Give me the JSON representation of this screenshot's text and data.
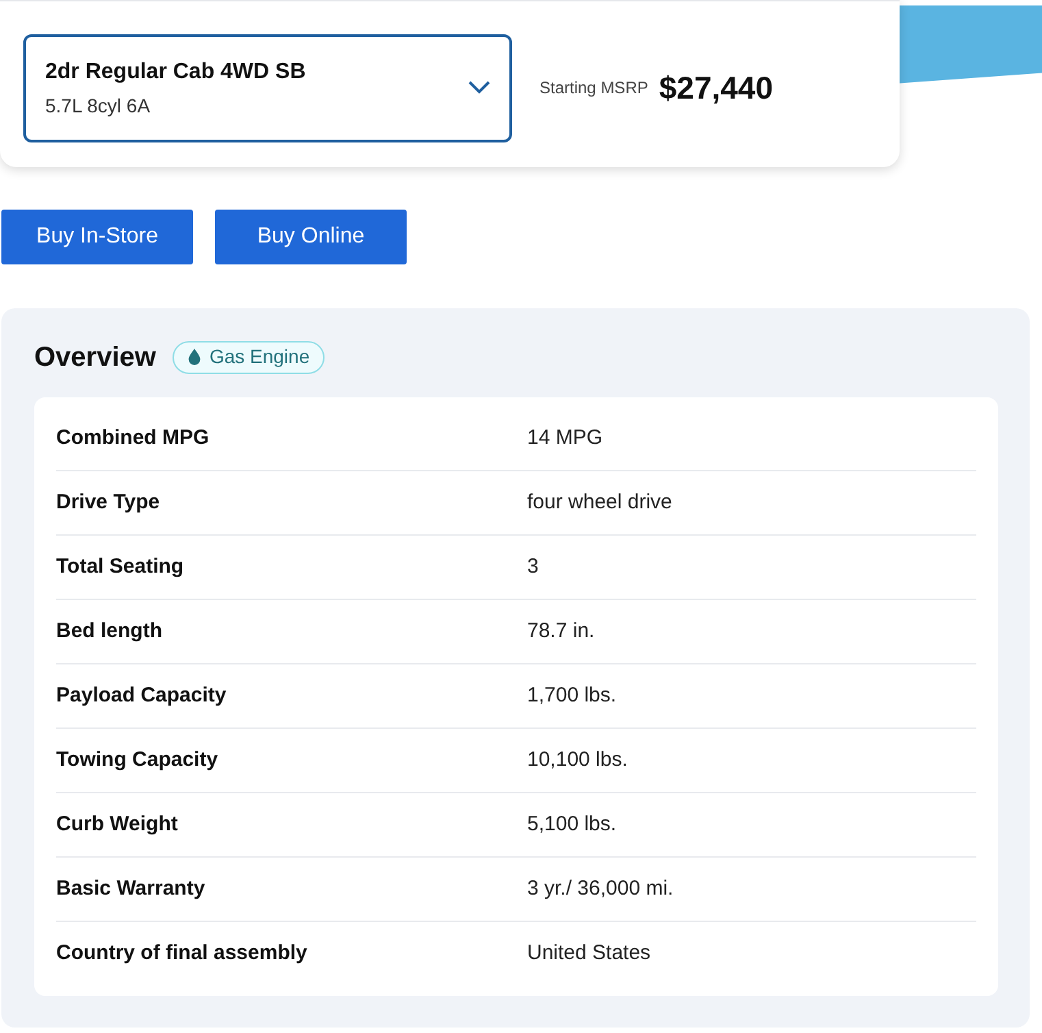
{
  "trim": {
    "name": "2dr Regular Cab 4WD SB",
    "engine": "5.7L 8cyl 6A"
  },
  "price": {
    "label": "Starting MSRP",
    "value": "$27,440"
  },
  "buttons": [
    "Buy In-Store",
    "Buy Online"
  ],
  "overview": {
    "title": "Overview",
    "badge": "Gas Engine",
    "rows": [
      {
        "label": "Combined MPG",
        "value": "14 MPG"
      },
      {
        "label": "Drive Type",
        "value": "four wheel drive"
      },
      {
        "label": "Total Seating",
        "value": "3"
      },
      {
        "label": "Bed length",
        "value": "78.7 in."
      },
      {
        "label": "Payload Capacity",
        "value": "1,700 lbs."
      },
      {
        "label": "Towing Capacity",
        "value": "10,100 lbs."
      },
      {
        "label": "Curb Weight",
        "value": "5,100 lbs."
      },
      {
        "label": "Basic Warranty",
        "value": "3 yr./ 36,000 mi."
      },
      {
        "label": "Country of final assembly",
        "value": "United States"
      }
    ]
  }
}
